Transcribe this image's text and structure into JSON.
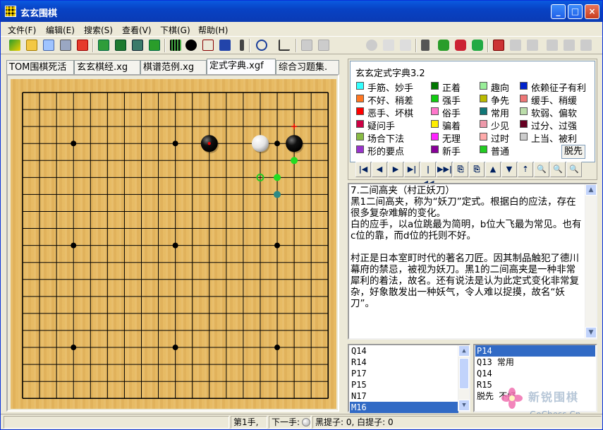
{
  "window": {
    "title": "玄玄围棋",
    "controls": [
      "_",
      "□",
      "×"
    ]
  },
  "menu": [
    {
      "label": "文件(F)"
    },
    {
      "label": "编辑(E)"
    },
    {
      "label": "搜索(S)"
    },
    {
      "label": "查看(V)"
    },
    {
      "label": "下棋(G)"
    },
    {
      "label": "帮助(H)"
    }
  ],
  "tabs": [
    {
      "label": "TOM围棋死活"
    },
    {
      "label": "玄玄棋经.xg"
    },
    {
      "label": "棋谱范例.xg"
    },
    {
      "label": "定式字典.xgf",
      "active": true
    },
    {
      "label": "综合习题集."
    }
  ],
  "board": {
    "size": 19,
    "stones": [
      {
        "col": 11,
        "row": 3,
        "color": "black",
        "marker": "red-dot"
      },
      {
        "col": 14,
        "row": 3,
        "color": "white"
      },
      {
        "col": 16,
        "row": 3,
        "color": "black"
      }
    ],
    "markers": [
      {
        "col": 16,
        "row": 2,
        "type": "red-cross"
      },
      {
        "col": 16,
        "row": 4,
        "type": "green-dot"
      },
      {
        "col": 14,
        "row": 5,
        "type": "green-ring"
      },
      {
        "col": 15,
        "row": 5,
        "type": "green-dot"
      },
      {
        "col": 15,
        "row": 6,
        "type": "teal-dot"
      }
    ]
  },
  "dictionary": {
    "title": "玄玄定式字典3.2",
    "legend": [
      {
        "label": "手筋、妙手",
        "color": "#33ffff"
      },
      {
        "label": "正着",
        "color": "#007700"
      },
      {
        "label": "趣向",
        "color": "#99ee99"
      },
      {
        "label": "依赖征子有利",
        "color": "#0022cc"
      },
      {
        "label": "不好、稍差",
        "color": "#ff7722"
      },
      {
        "label": "强手",
        "color": "#11cc11"
      },
      {
        "label": "争先",
        "color": "#bbbb00"
      },
      {
        "label": "缓手、稍缓",
        "color": "#ee7777"
      },
      {
        "label": "恶手、坏棋",
        "color": "#ff0000"
      },
      {
        "label": "俗手",
        "color": "#ff77cc"
      },
      {
        "label": "常用",
        "color": "#117777"
      },
      {
        "label": "软弱、偏软",
        "color": "#bbddaa"
      },
      {
        "label": "疑问手",
        "color": "#cc0044"
      },
      {
        "label": "骗着",
        "color": "#ffee00"
      },
      {
        "label": "少见",
        "color": "#ee99aa"
      },
      {
        "label": "过分、过强",
        "color": "#660022"
      },
      {
        "label": "场合下法",
        "color": "#88bb44"
      },
      {
        "label": "无理",
        "color": "#ff22ff"
      },
      {
        "label": "过时",
        "color": "#ffaaaa"
      },
      {
        "label": "上当、被利",
        "color": "#cccccc"
      },
      {
        "label": "形的要点",
        "color": "#9933cc"
      },
      {
        "label": "新手",
        "color": "#880099"
      },
      {
        "label": "普通",
        "color": "#22cc22"
      }
    ],
    "tuoxian_label": "脱先"
  },
  "nav_buttons": [
    "|◀",
    "◀",
    "▶",
    "▶|",
    "|◀◀",
    "▶▶|",
    "⎘",
    "⎘",
    "▲",
    "▼",
    "⇡",
    "🔍",
    "🔍",
    "🔍"
  ],
  "comment": {
    "text": "7.二间高夹（村正妖刀）\n黑1二间高夹，称为“妖刀”定式。根据白的应法，存在很多复杂难解的变化。\n白的应手，以a位跳最为简明，b位大飞最为常见。也有c位的靠，而d位的托则不好。\n\n村正是日本室町时代的著名刀匠。因其制品触犯了德川幕府的禁忌，被视为妖刀。黑1的二间高夹是一种非常犀利的着法，故名。还有说法是认为此定式变化非常复杂，好象散发出一种妖气，令人难以捉摸，故名“妖刀”。"
  },
  "move_list_left": [
    "Q14",
    "R14",
    "P17",
    "P15",
    "N17",
    "M16"
  ],
  "move_list_left_selected": 5,
  "move_list_right": [
    "P14",
    "Q13 常用",
    "Q14",
    "R15",
    "脱先 不好"
  ],
  "move_list_right_selected": 0,
  "status": {
    "move": "第1手,",
    "next": "下一手:",
    "captures": "黑提子: 0, 白提子: 0"
  },
  "watermark": {
    "line1": "新锐围棋",
    "line2": "GoChess.Cn"
  }
}
